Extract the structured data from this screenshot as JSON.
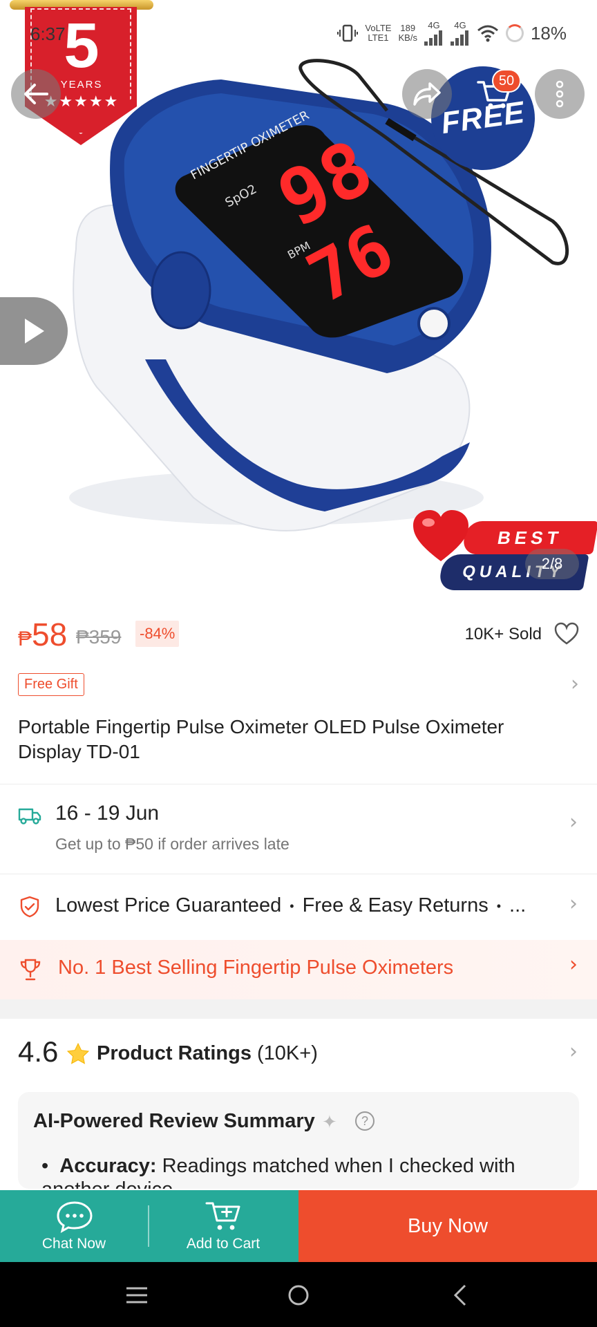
{
  "status_bar": {
    "time": "6:37",
    "net_top": "VoLTE",
    "net_bottom": "LTE1",
    "speed_value": "189",
    "speed_unit": "KB/s",
    "sig1": "4G",
    "sig2": "4G",
    "battery": "18%"
  },
  "hero": {
    "badge_number": "5",
    "badge_years": "YEARS",
    "badge_stars": "★★★★★",
    "free_label": "FREE",
    "cart_count": "50",
    "best_label": "BEST",
    "quality_label": "QUALITY",
    "pager": "2/8",
    "device_screen_spo2": "98",
    "device_screen_bpm": "76"
  },
  "price": {
    "currency": "₱",
    "current": "58",
    "original": "₱359",
    "discount": "-84%",
    "sold": "10K+ Sold"
  },
  "gift": {
    "label": "Free Gift"
  },
  "product_title": "Portable Fingertip Pulse Oximeter OLED Pulse Oximeter Display TD-01",
  "shipping": {
    "date_range": "16 - 19 Jun",
    "late_note": "Get up to ₱50 if order arrives late"
  },
  "guarantees": {
    "item1": "Lowest Price Guaranteed",
    "item2": "Free & Easy Returns",
    "more": "..."
  },
  "best_selling": "No. 1 Best Selling Fingertip Pulse Oximeters",
  "ratings": {
    "score": "4.6",
    "label": "Product Ratings",
    "count": "(10K+)"
  },
  "ai_summary": {
    "title": "AI-Powered Review Summary",
    "bullet_label": "Accuracy:",
    "bullet_text": " Readings matched when I checked with another device."
  },
  "bottom_bar": {
    "chat": "Chat Now",
    "add_cart": "Add to Cart",
    "buy_now": "Buy Now"
  },
  "colors": {
    "brand_orange": "#ee4d2d",
    "teal": "#26aa99",
    "device_blue": "#1d3f94"
  },
  "icons": [
    "back-arrow-icon",
    "share-icon",
    "cart-icon",
    "more-vertical-icon",
    "play-icon",
    "heart-outline-icon",
    "chevron-right-icon",
    "truck-icon",
    "shield-check-icon",
    "trophy-icon",
    "star-icon",
    "sparkle-icon",
    "help-icon",
    "chat-bubble-icon",
    "add-cart-icon",
    "nav-menu-icon",
    "nav-home-icon",
    "nav-back-icon"
  ]
}
